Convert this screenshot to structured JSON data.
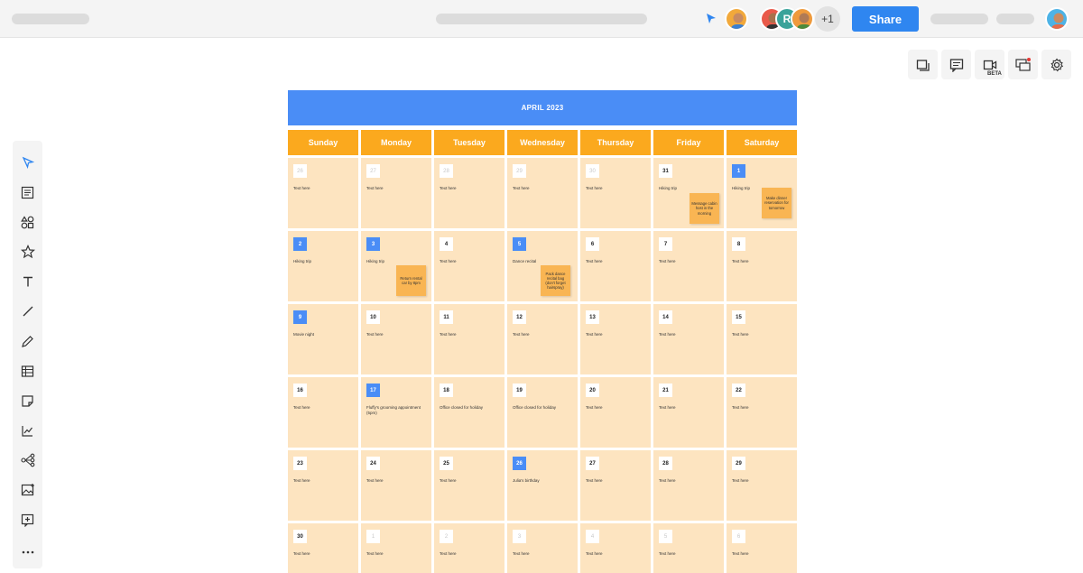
{
  "topbar": {
    "share_label": "Share",
    "collab_letter": "R",
    "more_collaborators": "+1"
  },
  "right_tools": [
    {
      "name": "frames-icon"
    },
    {
      "name": "comments-icon"
    },
    {
      "name": "video-icon",
      "badge": "BETA"
    },
    {
      "name": "chat-icon"
    },
    {
      "name": "settings-icon"
    }
  ],
  "calendar": {
    "title": "APRIL 2023",
    "days": [
      "Sunday",
      "Monday",
      "Tuesday",
      "Wednesday",
      "Thursday",
      "Friday",
      "Saturday"
    ],
    "weeks": [
      [
        {
          "date": "26",
          "text": "Text here",
          "style": "faded"
        },
        {
          "date": "27",
          "text": "Text here",
          "style": "faded"
        },
        {
          "date": "28",
          "text": "Text here",
          "style": "faded"
        },
        {
          "date": "29",
          "text": "Text here",
          "style": "faded"
        },
        {
          "date": "30",
          "text": "Text here",
          "style": "faded"
        },
        {
          "date": "31",
          "text": "Hiking trip",
          "style": "normal"
        },
        {
          "date": "1",
          "text": "Hiking trip",
          "style": "blue"
        }
      ],
      [
        {
          "date": "2",
          "text": "Hiking trip",
          "style": "blue"
        },
        {
          "date": "3",
          "text": "Hiking trip",
          "style": "blue"
        },
        {
          "date": "4",
          "text": "Text here",
          "style": "normal"
        },
        {
          "date": "5",
          "text": "Dance recital",
          "style": "blue"
        },
        {
          "date": "6",
          "text": "Text here",
          "style": "normal"
        },
        {
          "date": "7",
          "text": "Text here",
          "style": "normal"
        },
        {
          "date": "8",
          "text": "Text here",
          "style": "normal"
        }
      ],
      [
        {
          "date": "9",
          "text": "Movie night",
          "style": "blue"
        },
        {
          "date": "10",
          "text": "Text here",
          "style": "normal"
        },
        {
          "date": "11",
          "text": "Text here",
          "style": "normal"
        },
        {
          "date": "12",
          "text": "Text here",
          "style": "normal"
        },
        {
          "date": "13",
          "text": "Text here",
          "style": "normal"
        },
        {
          "date": "14",
          "text": "Text here",
          "style": "normal"
        },
        {
          "date": "15",
          "text": "Text here",
          "style": "normal"
        }
      ],
      [
        {
          "date": "16",
          "text": "Text here",
          "style": "normal"
        },
        {
          "date": "17",
          "text": "Fluffy's grooming appointment (5pm)",
          "style": "blue"
        },
        {
          "date": "18",
          "text": "Office closed for holiday",
          "style": "normal"
        },
        {
          "date": "19",
          "text": "Office closed for holiday",
          "style": "normal"
        },
        {
          "date": "20",
          "text": "Text here",
          "style": "normal"
        },
        {
          "date": "21",
          "text": "Text here",
          "style": "normal"
        },
        {
          "date": "22",
          "text": "Text here",
          "style": "normal"
        }
      ],
      [
        {
          "date": "23",
          "text": "Text here",
          "style": "normal"
        },
        {
          "date": "24",
          "text": "Text here",
          "style": "normal"
        },
        {
          "date": "25",
          "text": "Text here",
          "style": "normal"
        },
        {
          "date": "26",
          "text": "Julia's birthday",
          "style": "blue"
        },
        {
          "date": "27",
          "text": "Text here",
          "style": "normal"
        },
        {
          "date": "28",
          "text": "Text here",
          "style": "normal"
        },
        {
          "date": "29",
          "text": "Text here",
          "style": "normal"
        }
      ],
      [
        {
          "date": "30",
          "text": "Text here",
          "style": "normal"
        },
        {
          "date": "1",
          "text": "Text here",
          "style": "faded"
        },
        {
          "date": "2",
          "text": "Text here",
          "style": "faded"
        },
        {
          "date": "3",
          "text": "Text here",
          "style": "faded"
        },
        {
          "date": "4",
          "text": "Text here",
          "style": "faded"
        },
        {
          "date": "5",
          "text": "Text here",
          "style": "faded"
        },
        {
          "date": "6",
          "text": "Text here",
          "style": "faded"
        }
      ]
    ],
    "stickies": [
      {
        "text": "Message cabin host in the morning"
      },
      {
        "text": "Make dinner reservation for tomorrow"
      },
      {
        "text": "Return rental car by 8pm"
      },
      {
        "text": "Pack dance recital bag (don't forget hairspray)"
      }
    ]
  },
  "colors": {
    "title_bar": "#4a8df6",
    "day_header": "#fba91e",
    "cell": "#fde4c0",
    "sticky": "#f9b553",
    "share": "#2f86f0"
  }
}
